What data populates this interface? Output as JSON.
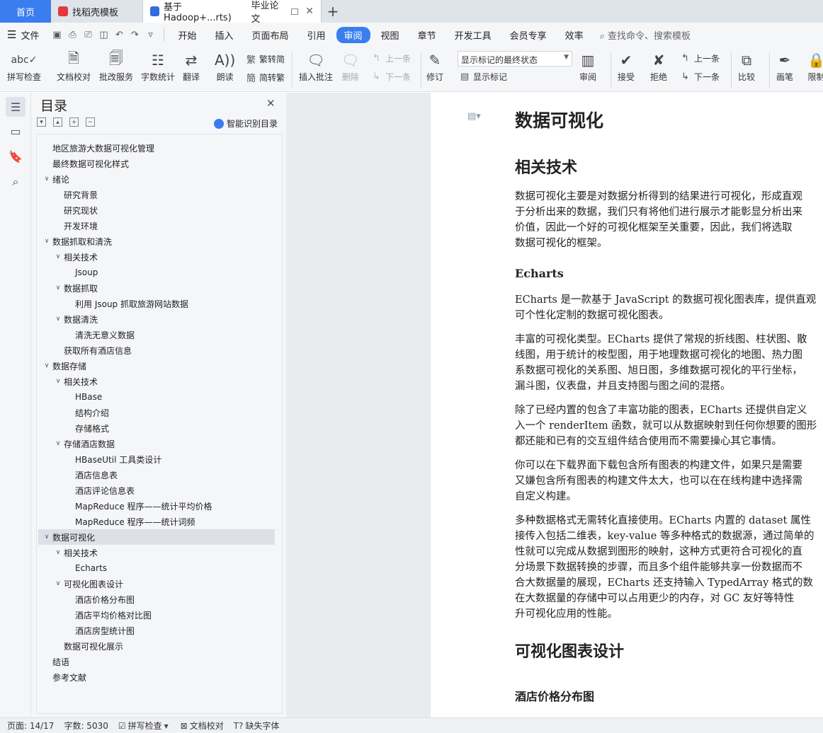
{
  "tabs": {
    "home": "首页",
    "tab1": "找稻壳模板",
    "tab2": "基于Hadoop+...rts)",
    "tab3": "毕业论文"
  },
  "menu": {
    "file": "文件",
    "items": [
      "开始",
      "插入",
      "页面布局",
      "引用",
      "审阅",
      "视图",
      "章节",
      "开发工具",
      "会员专享",
      "效率"
    ],
    "search": "查找命令、搜索模板"
  },
  "ribbon": {
    "spell": "拼写检查",
    "proof": "文档校对",
    "revise": "批改服务",
    "count": "字数统计",
    "translate": "翻译",
    "read": "朗读",
    "t2s": "繁转简",
    "s2t": "简转繁",
    "insert_comment": "插入批注",
    "delete": "删除",
    "prev": "上一条",
    "next": "下一条",
    "track": "修订",
    "markup_select": "显示标记的最终状态",
    "show_markup": "显示标记",
    "review": "审阅",
    "accept": "接受",
    "reject": "拒绝",
    "prev2": "上一条",
    "next2": "下一条",
    "compare": "比较",
    "pen": "画笔",
    "restrict": "限制"
  },
  "toc": {
    "title": "目录",
    "smart": "智能识别目录",
    "items": [
      {
        "label": "地区旅游大数据可视化管理"
      },
      {
        "label": "最终数据可视化样式"
      },
      {
        "label": "绪论"
      },
      {
        "label": "研究背景"
      },
      {
        "label": "研究现状"
      },
      {
        "label": "开发环境"
      },
      {
        "label": "数据抓取和清洗"
      },
      {
        "label": "相关技术"
      },
      {
        "label": "Jsoup"
      },
      {
        "label": "数据抓取"
      },
      {
        "label": "利用 Jsoup 抓取旅游网站数据"
      },
      {
        "label": "数据清洗"
      },
      {
        "label": "清洗无意义数据"
      },
      {
        "label": "获取所有酒店信息"
      },
      {
        "label": "数据存储"
      },
      {
        "label": "相关技术"
      },
      {
        "label": "HBase"
      },
      {
        "label": "结构介绍"
      },
      {
        "label": "存储格式"
      },
      {
        "label": "存储酒店数据"
      },
      {
        "label": "HBaseUtil 工具类设计"
      },
      {
        "label": "酒店信息表"
      },
      {
        "label": "酒店评论信息表"
      },
      {
        "label": "MapReduce 程序——统计平均价格"
      },
      {
        "label": "MapReduce 程序——统计词频"
      },
      {
        "label": "数据可视化"
      },
      {
        "label": "相关技术"
      },
      {
        "label": "Echarts"
      },
      {
        "label": "可视化图表设计"
      },
      {
        "label": "酒店价格分布图"
      },
      {
        "label": "酒店平均价格对比图"
      },
      {
        "label": "酒店房型统计图"
      },
      {
        "label": "数据可视化展示"
      },
      {
        "label": "结语"
      },
      {
        "label": "参考文献"
      }
    ]
  },
  "doc": {
    "h1": "数据可视化",
    "h2a": "相关技术",
    "p1": [
      "数据可视化主要是对数据分析得到的结果进行可视化，形成直观",
      "于分析出来的数据，我们只有将他们进行展示才能彰显分析出来",
      "价值，因此一个好的可视化框架至关重要，因此，我们将选取",
      "数据可视化的框架。"
    ],
    "h3a": "Echarts",
    "p2": [
      "ECharts 是一款基于 JavaScript 的数据可视化图表库，提供直观",
      "可个性化定制的数据可视化图表。"
    ],
    "p3": [
      "丰富的可视化类型。ECharts 提供了常规的折线图、柱状图、散",
      "线图，用于统计的桉型图，用于地理数据可视化的地图、热力图",
      "系数据可视化的关系图、旭日图，多维数据可视化的平行坐标，",
      "漏斗图，仪表盘，并且支持图与图之间的混搭。"
    ],
    "p4": [
      "除了已经内置的包含了丰富功能的图表，ECharts 还提供自定义",
      "入一个 renderItem 函数，就可以从数据映射到任何你想要的图形",
      "都还能和已有的交互组件结合使用而不需要操心其它事情。"
    ],
    "p5": [
      "你可以在下载界面下载包含所有图表的构建文件，如果只是需要",
      "又嫌包含所有图表的构建文件太大，也可以在在线构建中选择需",
      "自定义构建。"
    ],
    "p6": [
      "多种数据格式无需转化直接使用。ECharts 内置的 dataset 属性",
      "接传入包括二维表，key-value 等多种格式的数据源，通过简单的",
      "性就可以完成从数据到图形的映射，这种方式更符合可视化的直",
      "分场景下数据转换的步骤，而且多个组件能够共享一份数据而不",
      "合大数据量的展现，ECharts 还支持输入 TypedArray 格式的数",
      "在大数据量的存储中可以占用更少的内存，对 GC 友好等特性",
      "升可视化应用的性能。"
    ],
    "h2b": "可视化图表设计",
    "h3b": "酒店价格分布图"
  },
  "status": {
    "page": "页面: 14/17",
    "words": "字数: 5030",
    "spell": "拼写检查",
    "proof": "文档校对",
    "font": "缺失字体"
  }
}
